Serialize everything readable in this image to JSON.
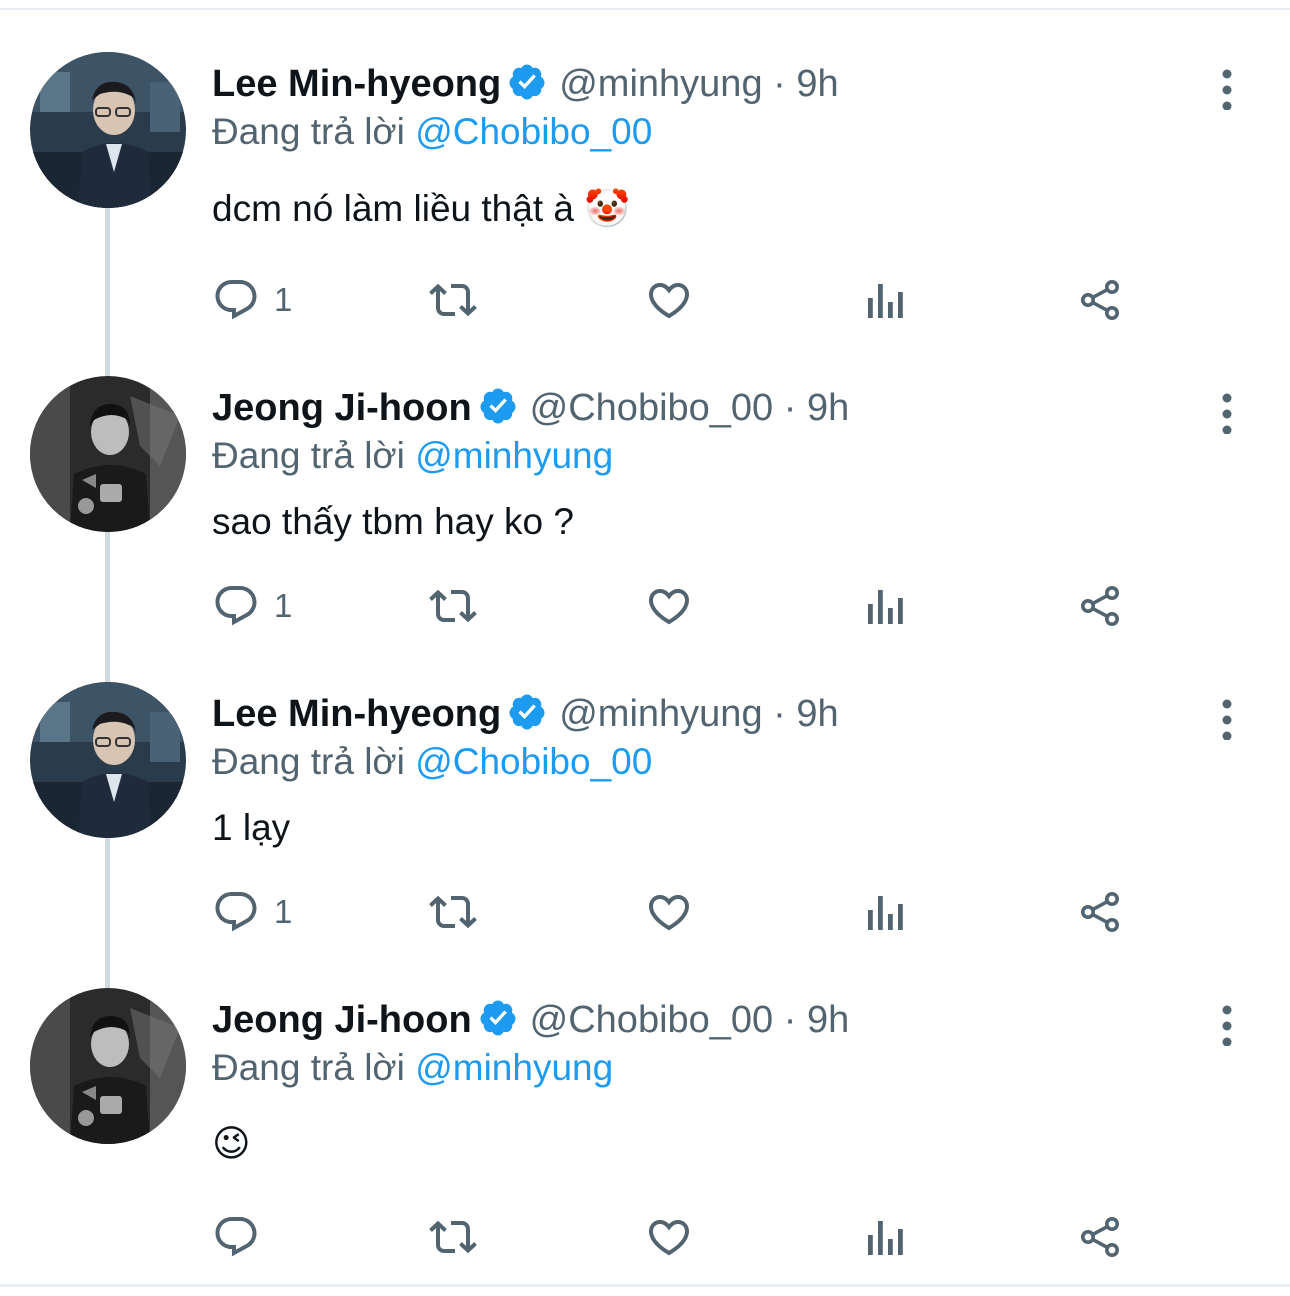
{
  "replying_label": "Đang trả lời",
  "tweets": [
    {
      "name": "Lee Min-hyeong",
      "handle": "@minhyung",
      "dot": "·",
      "time": "9h",
      "reply_to": "@Chobibo_00",
      "text": "dcm nó làm liều thật à 🤡",
      "reply_count": "1",
      "avatar": "lee-min-hyeong-avatar"
    },
    {
      "name": "Jeong Ji-hoon",
      "handle": "@Chobibo_00",
      "dot": "·",
      "time": "9h",
      "reply_to": "@minhyung",
      "text": "sao thấy tbm hay ko ?",
      "reply_count": "1",
      "avatar": "jeong-ji-hoon-avatar"
    },
    {
      "name": "Lee Min-hyeong",
      "handle": "@minhyung",
      "dot": "·",
      "time": "9h",
      "reply_to": "@Chobibo_00",
      "text": "1 lạy",
      "reply_count": "1",
      "avatar": "lee-min-hyeong-avatar"
    },
    {
      "name": "Jeong Ji-hoon",
      "handle": "@Chobibo_00",
      "dot": "·",
      "time": "9h",
      "reply_to": "@minhyung",
      "text": "😉",
      "reply_count": "",
      "avatar": "jeong-ji-hoon-avatar"
    }
  ],
  "icons": {
    "verified": "verified-badge-icon",
    "more": "more-vertical-icon",
    "reply": "reply-icon",
    "retweet": "retweet-icon",
    "like": "like-icon",
    "views": "views-icon",
    "share": "share-icon"
  },
  "colors": {
    "accent": "#1d9bf0",
    "secondary_text": "#536471",
    "thread_line": "#cfd9de"
  }
}
